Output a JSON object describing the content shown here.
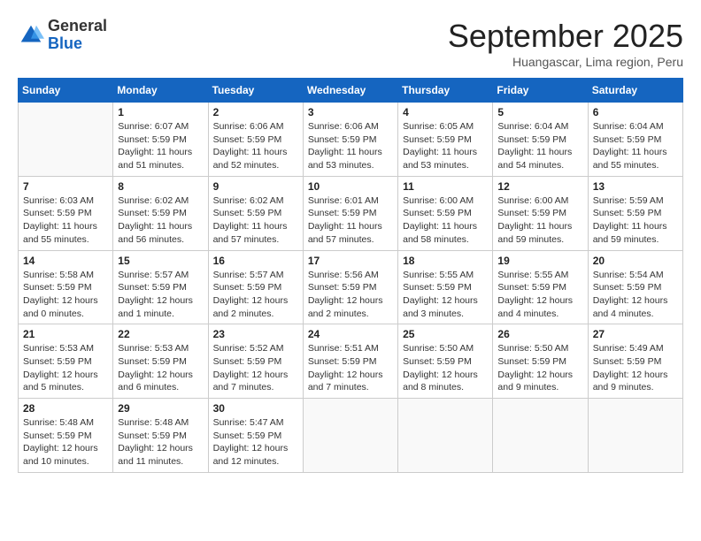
{
  "logo": {
    "general": "General",
    "blue": "Blue"
  },
  "header": {
    "month": "September 2025",
    "location": "Huangascar, Lima region, Peru"
  },
  "days_of_week": [
    "Sunday",
    "Monday",
    "Tuesday",
    "Wednesday",
    "Thursday",
    "Friday",
    "Saturday"
  ],
  "weeks": [
    [
      {
        "day": "",
        "sunrise": "",
        "sunset": "",
        "daylight": ""
      },
      {
        "day": "1",
        "sunrise": "Sunrise: 6:07 AM",
        "sunset": "Sunset: 5:59 PM",
        "daylight": "Daylight: 11 hours and 51 minutes."
      },
      {
        "day": "2",
        "sunrise": "Sunrise: 6:06 AM",
        "sunset": "Sunset: 5:59 PM",
        "daylight": "Daylight: 11 hours and 52 minutes."
      },
      {
        "day": "3",
        "sunrise": "Sunrise: 6:06 AM",
        "sunset": "Sunset: 5:59 PM",
        "daylight": "Daylight: 11 hours and 53 minutes."
      },
      {
        "day": "4",
        "sunrise": "Sunrise: 6:05 AM",
        "sunset": "Sunset: 5:59 PM",
        "daylight": "Daylight: 11 hours and 53 minutes."
      },
      {
        "day": "5",
        "sunrise": "Sunrise: 6:04 AM",
        "sunset": "Sunset: 5:59 PM",
        "daylight": "Daylight: 11 hours and 54 minutes."
      },
      {
        "day": "6",
        "sunrise": "Sunrise: 6:04 AM",
        "sunset": "Sunset: 5:59 PM",
        "daylight": "Daylight: 11 hours and 55 minutes."
      }
    ],
    [
      {
        "day": "7",
        "sunrise": "Sunrise: 6:03 AM",
        "sunset": "Sunset: 5:59 PM",
        "daylight": "Daylight: 11 hours and 55 minutes."
      },
      {
        "day": "8",
        "sunrise": "Sunrise: 6:02 AM",
        "sunset": "Sunset: 5:59 PM",
        "daylight": "Daylight: 11 hours and 56 minutes."
      },
      {
        "day": "9",
        "sunrise": "Sunrise: 6:02 AM",
        "sunset": "Sunset: 5:59 PM",
        "daylight": "Daylight: 11 hours and 57 minutes."
      },
      {
        "day": "10",
        "sunrise": "Sunrise: 6:01 AM",
        "sunset": "Sunset: 5:59 PM",
        "daylight": "Daylight: 11 hours and 57 minutes."
      },
      {
        "day": "11",
        "sunrise": "Sunrise: 6:00 AM",
        "sunset": "Sunset: 5:59 PM",
        "daylight": "Daylight: 11 hours and 58 minutes."
      },
      {
        "day": "12",
        "sunrise": "Sunrise: 6:00 AM",
        "sunset": "Sunset: 5:59 PM",
        "daylight": "Daylight: 11 hours and 59 minutes."
      },
      {
        "day": "13",
        "sunrise": "Sunrise: 5:59 AM",
        "sunset": "Sunset: 5:59 PM",
        "daylight": "Daylight: 11 hours and 59 minutes."
      }
    ],
    [
      {
        "day": "14",
        "sunrise": "Sunrise: 5:58 AM",
        "sunset": "Sunset: 5:59 PM",
        "daylight": "Daylight: 12 hours and 0 minutes."
      },
      {
        "day": "15",
        "sunrise": "Sunrise: 5:57 AM",
        "sunset": "Sunset: 5:59 PM",
        "daylight": "Daylight: 12 hours and 1 minute."
      },
      {
        "day": "16",
        "sunrise": "Sunrise: 5:57 AM",
        "sunset": "Sunset: 5:59 PM",
        "daylight": "Daylight: 12 hours and 2 minutes."
      },
      {
        "day": "17",
        "sunrise": "Sunrise: 5:56 AM",
        "sunset": "Sunset: 5:59 PM",
        "daylight": "Daylight: 12 hours and 2 minutes."
      },
      {
        "day": "18",
        "sunrise": "Sunrise: 5:55 AM",
        "sunset": "Sunset: 5:59 PM",
        "daylight": "Daylight: 12 hours and 3 minutes."
      },
      {
        "day": "19",
        "sunrise": "Sunrise: 5:55 AM",
        "sunset": "Sunset: 5:59 PM",
        "daylight": "Daylight: 12 hours and 4 minutes."
      },
      {
        "day": "20",
        "sunrise": "Sunrise: 5:54 AM",
        "sunset": "Sunset: 5:59 PM",
        "daylight": "Daylight: 12 hours and 4 minutes."
      }
    ],
    [
      {
        "day": "21",
        "sunrise": "Sunrise: 5:53 AM",
        "sunset": "Sunset: 5:59 PM",
        "daylight": "Daylight: 12 hours and 5 minutes."
      },
      {
        "day": "22",
        "sunrise": "Sunrise: 5:53 AM",
        "sunset": "Sunset: 5:59 PM",
        "daylight": "Daylight: 12 hours and 6 minutes."
      },
      {
        "day": "23",
        "sunrise": "Sunrise: 5:52 AM",
        "sunset": "Sunset: 5:59 PM",
        "daylight": "Daylight: 12 hours and 7 minutes."
      },
      {
        "day": "24",
        "sunrise": "Sunrise: 5:51 AM",
        "sunset": "Sunset: 5:59 PM",
        "daylight": "Daylight: 12 hours and 7 minutes."
      },
      {
        "day": "25",
        "sunrise": "Sunrise: 5:50 AM",
        "sunset": "Sunset: 5:59 PM",
        "daylight": "Daylight: 12 hours and 8 minutes."
      },
      {
        "day": "26",
        "sunrise": "Sunrise: 5:50 AM",
        "sunset": "Sunset: 5:59 PM",
        "daylight": "Daylight: 12 hours and 9 minutes."
      },
      {
        "day": "27",
        "sunrise": "Sunrise: 5:49 AM",
        "sunset": "Sunset: 5:59 PM",
        "daylight": "Daylight: 12 hours and 9 minutes."
      }
    ],
    [
      {
        "day": "28",
        "sunrise": "Sunrise: 5:48 AM",
        "sunset": "Sunset: 5:59 PM",
        "daylight": "Daylight: 12 hours and 10 minutes."
      },
      {
        "day": "29",
        "sunrise": "Sunrise: 5:48 AM",
        "sunset": "Sunset: 5:59 PM",
        "daylight": "Daylight: 12 hours and 11 minutes."
      },
      {
        "day": "30",
        "sunrise": "Sunrise: 5:47 AM",
        "sunset": "Sunset: 5:59 PM",
        "daylight": "Daylight: 12 hours and 12 minutes."
      },
      {
        "day": "",
        "sunrise": "",
        "sunset": "",
        "daylight": ""
      },
      {
        "day": "",
        "sunrise": "",
        "sunset": "",
        "daylight": ""
      },
      {
        "day": "",
        "sunrise": "",
        "sunset": "",
        "daylight": ""
      },
      {
        "day": "",
        "sunrise": "",
        "sunset": "",
        "daylight": ""
      }
    ]
  ]
}
